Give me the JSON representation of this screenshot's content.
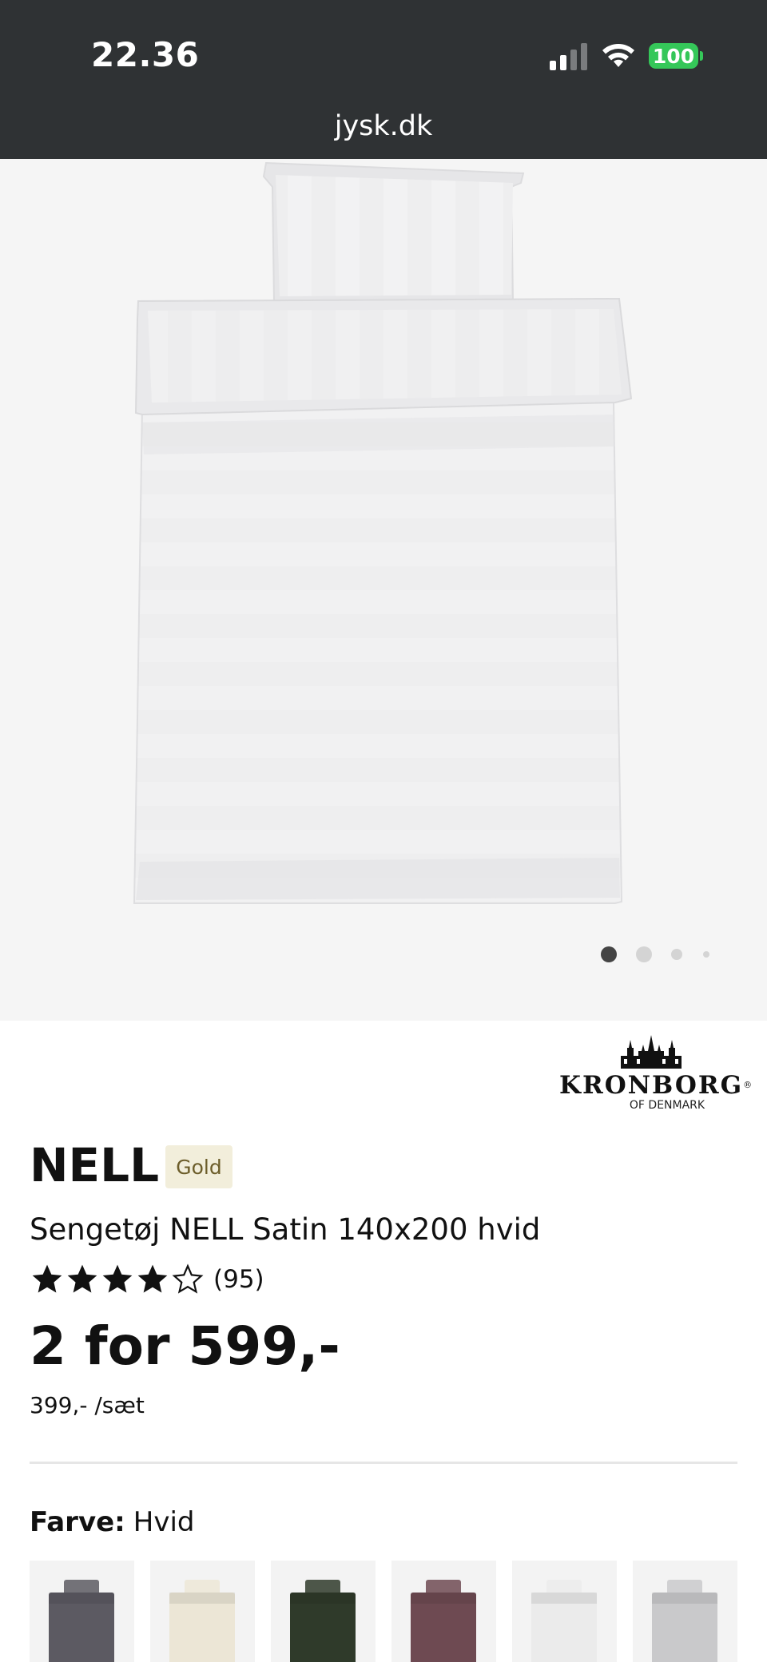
{
  "status_bar": {
    "time": "22.36",
    "battery": "100",
    "battery_color": "#35c759"
  },
  "browser": {
    "url": "jysk.dk"
  },
  "gallery": {
    "slide_count": 4,
    "active_index": 0
  },
  "brand": {
    "name": "KRONBORG",
    "registered": "®",
    "subline": "OF DENMARK"
  },
  "product": {
    "title": "NELL",
    "badge": "Gold",
    "subtitle": "Sengetøj NELL Satin 140x200 hvid",
    "rating": 4,
    "rating_max": 5,
    "review_count": "(95)",
    "price": "2 for 599,-",
    "unit_price": "399,- /sæt"
  },
  "color_selector": {
    "label": "Farve:",
    "value": "Hvid",
    "swatches": [
      {
        "name": "grå",
        "color": "#5c5a62"
      },
      {
        "name": "beige",
        "color": "#ece6d6"
      },
      {
        "name": "grøn",
        "color": "#2f3a2a"
      },
      {
        "name": "bordeaux",
        "color": "#6e4a52"
      },
      {
        "name": "hvid",
        "color": "#ebebeb"
      },
      {
        "name": "lysegrå",
        "color": "#c9c9cb"
      }
    ]
  },
  "colors": {
    "top_bar": "#2f3234",
    "badge_bg": "#f2eedb",
    "badge_text": "#6c5d2a"
  }
}
